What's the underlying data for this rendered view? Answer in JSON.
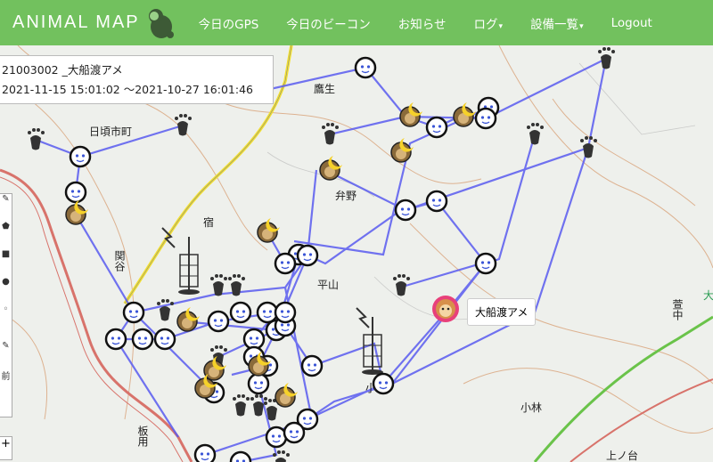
{
  "brand": {
    "name": "ANIMAL MAP"
  },
  "nav": {
    "items": [
      {
        "label": "今日のGPS"
      },
      {
        "label": "今日のビーコン"
      },
      {
        "label": "お知らせ"
      },
      {
        "label": "ログ"
      },
      {
        "label": "設備一覧"
      },
      {
        "label": "Logout"
      }
    ],
    "dropdown_caret": "▾"
  },
  "info": {
    "id_line": "21003002 _大船渡アメ",
    "range_line": "2021-11-15 15:01:02 ～2021-10-27 16:01:46"
  },
  "tooltip": {
    "text": "大船渡アメ"
  },
  "map_labels": {
    "l1": "鷹生",
    "l2": "日頃市町",
    "l3": "弁野",
    "l4": "宿",
    "l5": "関谷",
    "l6": "平山",
    "l7": "小林",
    "l8": "板用",
    "l9": "上ノ台",
    "l10": "萱中",
    "l11": "小",
    "l12": "大"
  },
  "toolbar": {
    "tools": [
      "✎",
      "⬟",
      "■",
      "●",
      "◦"
    ],
    "extra": [
      "✎",
      "前"
    ],
    "bottom": "+"
  },
  "colors": {
    "navbar": "#72c15e",
    "track": "#5a5cf0",
    "road_yellow": "#f2e030",
    "road_red": "#d8736b",
    "boundary": "#6ac34a"
  }
}
